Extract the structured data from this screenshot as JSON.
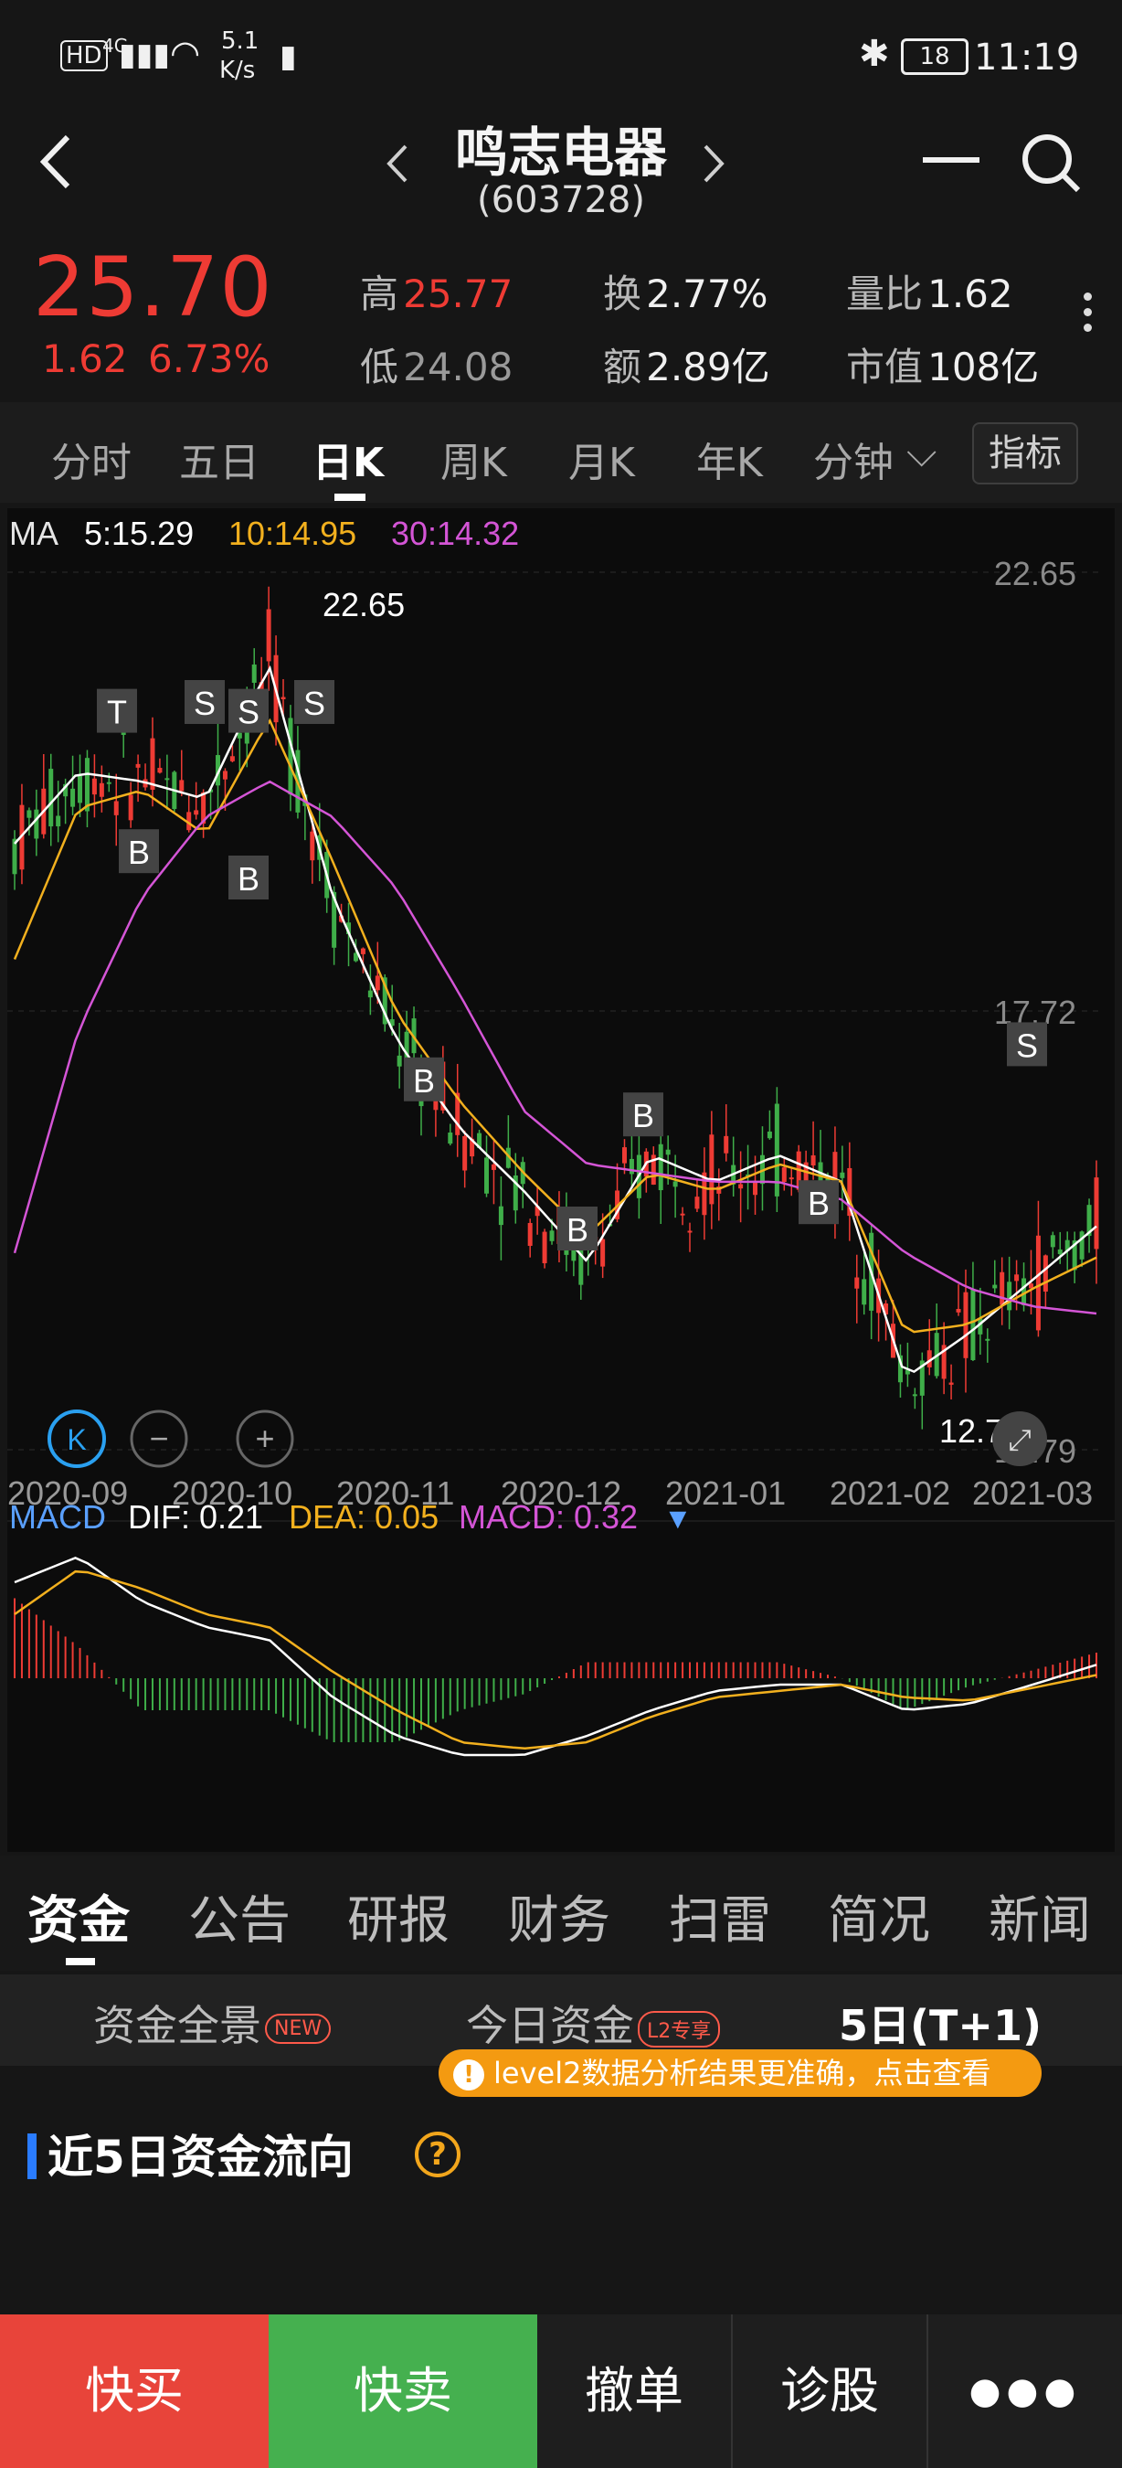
{
  "status": {
    "net": "4G",
    "speed_val": "5.1",
    "speed_unit": "K/s",
    "battery": "18",
    "time": "11:19"
  },
  "header": {
    "title": "鸣志电器",
    "code": "(603728)"
  },
  "quote": {
    "price": "25.70",
    "change": "1.62",
    "change_pct": "6.73%",
    "high_label": "高",
    "high": "25.77",
    "low_label": "低",
    "low": "24.08",
    "turnover_label": "换",
    "turnover": "2.77%",
    "amount_label": "额",
    "amount": "2.89亿",
    "vol_ratio_label": "量比",
    "vol_ratio": "1.62",
    "mcap_label": "市值",
    "mcap": "108亿"
  },
  "period_tabs": [
    "分时",
    "五日",
    "日K",
    "周K",
    "月K",
    "年K",
    "分钟"
  ],
  "indicator_btn": "指标",
  "ma": {
    "label": "MA",
    "ma5": "5:15.29",
    "ma10": "10:14.95",
    "ma30": "30:14.32"
  },
  "price_axis": {
    "top": "22.65",
    "mid": "17.72",
    "bottom": "12.79"
  },
  "annotations": {
    "high": "22.65",
    "low": "12.79"
  },
  "date_labels": [
    "2020-09",
    "2020-10",
    "2020-11",
    "2020-12",
    "2021-01",
    "2021-02",
    "2021-03"
  ],
  "macd": {
    "label": "MACD",
    "dif": "DIF: 0.21",
    "dea": "DEA: 0.05",
    "macd": "MACD: 0.32"
  },
  "chart_data": {
    "type": "candlestick",
    "x": [
      "2020-09",
      "2020-10",
      "2020-11",
      "2020-12",
      "2021-01",
      "2021-02",
      "2021-03"
    ],
    "ylim": [
      12.79,
      22.65
    ],
    "mid_tick": 17.72,
    "series": [
      {
        "name": "5",
        "values": [
          19.6,
          20.4,
          20.3,
          20.1,
          21.6,
          19.0,
          17.4,
          16.4,
          15.7,
          14.9,
          16.1,
          15.8,
          16.1,
          15.8,
          13.6,
          14.1,
          14.7,
          15.3
        ]
      },
      {
        "name": "10",
        "values": [
          18.3,
          20.0,
          20.2,
          19.7,
          21.0,
          19.4,
          17.7,
          16.7,
          15.9,
          15.2,
          15.9,
          15.7,
          16.0,
          15.8,
          14.1,
          14.2,
          14.6,
          14.95
        ]
      },
      {
        "name": "30",
        "values": [
          15.0,
          17.5,
          19.0,
          19.9,
          20.3,
          19.9,
          19.1,
          17.9,
          16.6,
          16.0,
          15.9,
          15.8,
          15.8,
          15.6,
          15.0,
          14.6,
          14.4,
          14.32
        ]
      }
    ],
    "macd": {
      "dif": [
        1.5,
        1.9,
        1.2,
        0.8,
        0.6,
        -0.3,
        -0.9,
        -1.2,
        -1.2,
        -0.9,
        -0.5,
        -0.2,
        -0.1,
        -0.1,
        -0.5,
        -0.4,
        -0.1,
        0.21
      ],
      "dea": [
        1.0,
        1.7,
        1.4,
        1.0,
        0.8,
        0.1,
        -0.5,
        -1.0,
        -1.1,
        -1.0,
        -0.6,
        -0.3,
        -0.2,
        -0.1,
        -0.3,
        -0.35,
        -0.15,
        0.05
      ]
    },
    "signals": [
      {
        "label": "T",
        "date": "2020-09"
      },
      {
        "label": "S",
        "date": "2020-09"
      },
      {
        "label": "S",
        "date": "2020-10"
      },
      {
        "label": "S",
        "date": "2020-10"
      },
      {
        "label": "B",
        "date": "2020-09"
      },
      {
        "label": "B",
        "date": "2020-10"
      },
      {
        "label": "B",
        "date": "2020-11"
      },
      {
        "label": "B",
        "date": "2020-12"
      },
      {
        "label": "B",
        "date": "2021-01"
      },
      {
        "label": "B",
        "date": "2021-02"
      },
      {
        "label": "S",
        "date": "2021-03"
      }
    ]
  },
  "section_tabs": [
    "资金",
    "公告",
    "研报",
    "财务",
    "扫雷",
    "简况",
    "新闻"
  ],
  "sub_tabs": {
    "overview": "资金全景",
    "overview_badge": "NEW",
    "today": "今日资金",
    "today_badge": "L2专享",
    "five_day": "5日(T+1)"
  },
  "banner": "level2数据分析结果更准确，点击查看",
  "flow_title": "近5日资金流向",
  "bottom_bar": {
    "buy": "快买",
    "sell": "快卖",
    "cancel": "撤单",
    "diagnose": "诊股"
  },
  "colors": {
    "up": "#ee3b34",
    "down": "#3fae49",
    "ma5": "#ffffff",
    "ma10": "#f2b01e",
    "ma30": "#d455d6",
    "accent": "#f49a11"
  }
}
